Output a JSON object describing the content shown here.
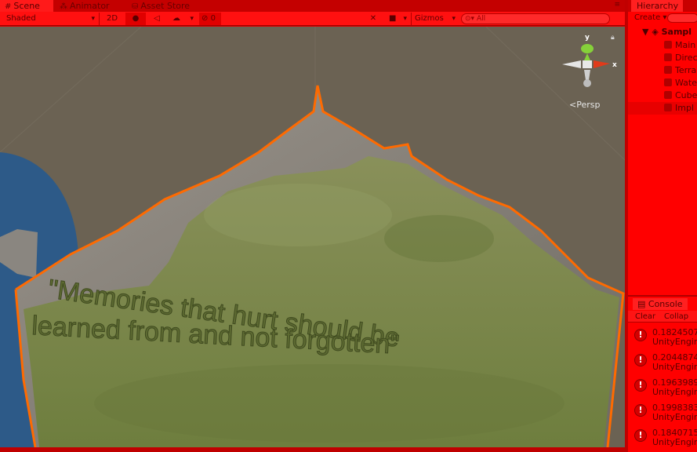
{
  "scene_window": {
    "tabs": [
      {
        "label": "Scene",
        "icon": "scene-icon"
      },
      {
        "label": "Animator",
        "icon": "animator-icon"
      },
      {
        "label": "Asset Store",
        "icon": "asset-store-icon"
      }
    ],
    "toolbar": {
      "draw_mode": "Shaded",
      "mode_2d": "2D",
      "hidden_count": "0",
      "gizmos": "Gizmos",
      "search_placeholder": "All"
    },
    "gizmo": {
      "y_label": "y",
      "x_label": "x",
      "projection": "Persp"
    },
    "world_text": {
      "line1": "\"Memories that hurt should be",
      "line2": "learned from and not forgotten\""
    }
  },
  "hierarchy": {
    "tab": "Hierarchy",
    "create": "Create",
    "root": "Sampl",
    "items": [
      {
        "label": "Main"
      },
      {
        "label": "Direc"
      },
      {
        "label": "Terra"
      },
      {
        "label": "Wate"
      },
      {
        "label": "Cube"
      },
      {
        "label": "Impl"
      }
    ]
  },
  "console": {
    "tab": "Console",
    "clear": "Clear",
    "collapse": "Collap",
    "logs": [
      {
        "value": "0.1824507",
        "source": "UnityEngin"
      },
      {
        "value": "0.2044874",
        "source": "UnityEngin"
      },
      {
        "value": "0.1963989",
        "source": "UnityEngin"
      },
      {
        "value": "0.1998383",
        "source": "UnityEngin"
      },
      {
        "value": "0.1840715",
        "source": "UnityEngin"
      }
    ]
  },
  "colors": {
    "playmode_tint": "#ff0000",
    "viewport_bg": "#6b6253",
    "grass": "#7f8a4a",
    "selection_outline": "#ff6a00",
    "water": "#2d5a88"
  }
}
